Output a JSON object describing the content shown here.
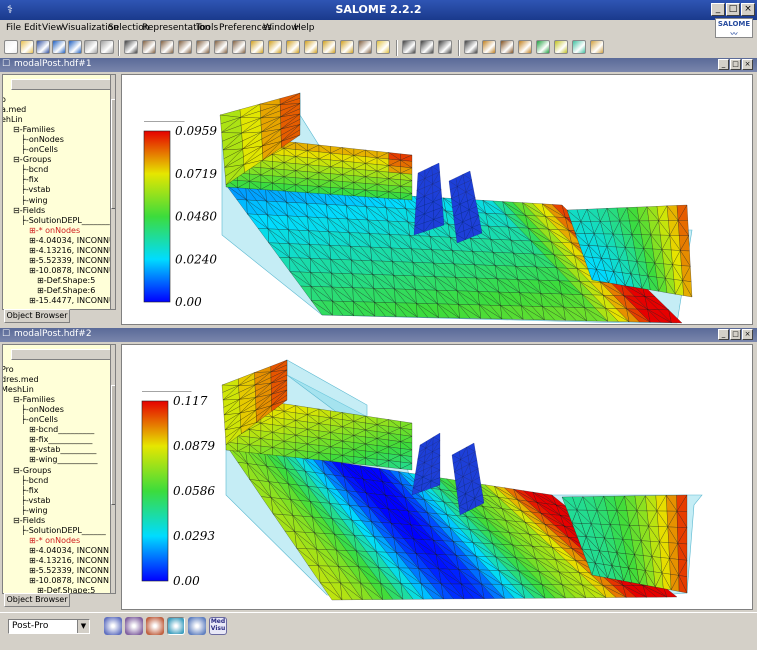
{
  "window": {
    "title": "SALOME 2.2.2",
    "minimize": "_",
    "maximize": "□",
    "close": "×"
  },
  "menu": [
    "File",
    "Edit",
    "View",
    "Visualization",
    "Selection",
    "Representation",
    "Tools",
    "Preferences",
    "Window",
    "Help"
  ],
  "logo_text": "SALOME",
  "toolbar_icons": [
    "new-file-icon",
    "open-file-icon",
    "save-icon",
    "undo-icon",
    "redo-icon",
    "copy-icon",
    "paste-icon",
    "dump-view-icon",
    "fit-all-icon",
    "fit-area-icon",
    "zoom-icon",
    "pan-icon",
    "global-pan-icon",
    "rotate-icon",
    "front-view-icon",
    "back-view-icon",
    "top-view-icon",
    "bottom-view-icon",
    "left-view-icon",
    "right-view-icon",
    "reset-view-icon",
    "trihedron-icon",
    "point-select-icon",
    "cell-select-icon",
    "edge-select-icon",
    "scalar-map-icon",
    "deformed-shape-icon",
    "vectors-icon",
    "iso-surfaces-icon",
    "cut-planes-icon",
    "cut-lines-icon",
    "stream-lines-icon",
    "scalar-map-on-deformed-icon"
  ],
  "views": [
    {
      "title": "modalPost.hdf#1",
      "tab_label": "Object Browser",
      "tree": [
        {
          "text": "o",
          "depth": 0
        },
        {
          "text": "a.med",
          "depth": 0
        },
        {
          "text": "ehLin",
          "depth": 0
        },
        {
          "text": "Families",
          "depth": 1
        },
        {
          "text": "onNodes",
          "depth": 2
        },
        {
          "text": "onCells",
          "depth": 2
        },
        {
          "text": "Groups",
          "depth": 1
        },
        {
          "text": "bcnd",
          "depth": 2
        },
        {
          "text": "fix",
          "depth": 2
        },
        {
          "text": "vstab",
          "depth": 2
        },
        {
          "text": "wing",
          "depth": 2
        },
        {
          "text": "Fields",
          "depth": 1
        },
        {
          "text": "SolutionDEPL_______",
          "depth": 2
        },
        {
          "text": "* onNodes",
          "depth": 3,
          "red": true
        },
        {
          "text": "4.04034, INCONNUI",
          "depth": 3
        },
        {
          "text": "4.13216, INCONNUI",
          "depth": 3
        },
        {
          "text": "5.52339, INCONNUI",
          "depth": 3
        },
        {
          "text": "10.0878, INCONNUI",
          "depth": 3
        },
        {
          "text": "Def.Shape:5",
          "depth": 4
        },
        {
          "text": "Def.Shape:6",
          "depth": 4
        },
        {
          "text": "15.4477, INCONNUI",
          "depth": 3
        }
      ],
      "scalar_bar": {
        "title": "_________",
        "labels": [
          "0.0959",
          "0.0719",
          "0.0480",
          "0.0240",
          "0.00"
        ],
        "max": 0.0959,
        "min": 0.0
      }
    },
    {
      "title": "modalPost.hdf#2",
      "tab_label": "Object Browser",
      "tree": [
        {
          "text": "Pro",
          "depth": 0
        },
        {
          "text": "dres.med",
          "depth": 0
        },
        {
          "text": "MeshLin",
          "depth": 0
        },
        {
          "text": "Families",
          "depth": 1
        },
        {
          "text": "onNodes",
          "depth": 2
        },
        {
          "text": "onCells",
          "depth": 2
        },
        {
          "text": "bcnd_________",
          "depth": 3
        },
        {
          "text": "fix___________",
          "depth": 3
        },
        {
          "text": "vstab_________",
          "depth": 3
        },
        {
          "text": "wing__________",
          "depth": 3
        },
        {
          "text": "Groups",
          "depth": 1
        },
        {
          "text": "bcnd",
          "depth": 2
        },
        {
          "text": "fix",
          "depth": 2
        },
        {
          "text": "vstab",
          "depth": 2
        },
        {
          "text": "wing",
          "depth": 2
        },
        {
          "text": "Fields",
          "depth": 1
        },
        {
          "text": "SolutionDEPL______",
          "depth": 2
        },
        {
          "text": "* onNodes",
          "depth": 3,
          "red": true
        },
        {
          "text": "4.04034, INCONN",
          "depth": 3
        },
        {
          "text": "4.13216, INCONN",
          "depth": 3
        },
        {
          "text": "5.52339, INCONN",
          "depth": 3
        },
        {
          "text": "10.0878, INCONN",
          "depth": 3
        },
        {
          "text": "Def.Shape:5",
          "depth": 4
        }
      ],
      "scalar_bar": {
        "title": "___________",
        "labels": [
          "0.117",
          "0.0879",
          "0.0586",
          "0.0293",
          "0.00"
        ],
        "max": 0.117,
        "min": 0.0
      }
    }
  ],
  "status": {
    "module": "Post-Pro",
    "module_icons": [
      "geometry-module-icon",
      "mesh-module-icon",
      "supervision-module-icon",
      "post-pro-module-icon",
      "visu-module-icon",
      "med-module-icon"
    ],
    "med_icon_text": "Med\nVisu"
  }
}
